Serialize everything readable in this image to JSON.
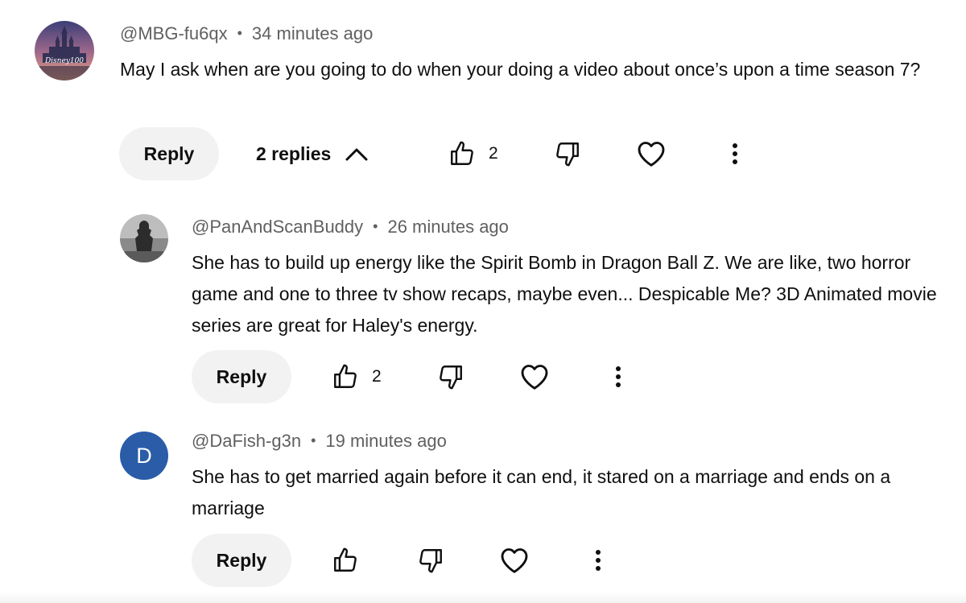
{
  "comments": [
    {
      "handle": "@MBG-fu6qx",
      "time": "34 minutes ago",
      "text": "May I ask when are you going to do when your doing a video about once’s upon a time season 7?",
      "avatar_text": "Disney100",
      "reply_label": "Reply",
      "replies_label": "2 replies",
      "likes": "2"
    },
    {
      "handle": "@PanAndScanBuddy",
      "time": "26 minutes ago",
      "text": "She has to build up energy like the Spirit Bomb in Dragon Ball Z. We are like, two horror game and one to three tv show recaps, maybe even... Despicable Me? 3D Animated movie series are great for Haley's energy.",
      "reply_label": "Reply",
      "likes": "2"
    },
    {
      "handle": "@DaFish-g3n",
      "time": "19 minutes ago",
      "text": "She has to get married again before it can end, it stared on a marriage and ends on a marriage",
      "avatar_letter": "D",
      "avatar_color": "#2a5ca8",
      "reply_label": "Reply"
    }
  ],
  "icons": {
    "like": "thumbs-up-icon",
    "dislike": "thumbs-down-icon",
    "heart": "heart-icon",
    "more": "more-vert-icon",
    "collapse": "chevron-up-icon"
  }
}
